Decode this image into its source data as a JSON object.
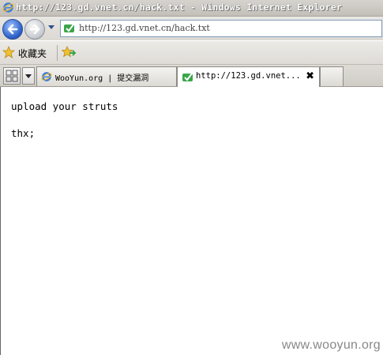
{
  "window": {
    "title": "http://123.gd.vnet.cn/hack.txt - Windows Internet Explorer"
  },
  "navigation": {
    "back_icon": "back-arrow-icon",
    "forward_icon": "forward-arrow-icon",
    "address_url": "http://123.gd.vnet.cn/hack.txt"
  },
  "favorites_bar": {
    "favorites_label": "收藏夹"
  },
  "tabs": [
    {
      "label": "WooYun.org | 提交漏洞",
      "active": false
    },
    {
      "label": "http://123.gd.vnet...",
      "active": true,
      "close": "✖"
    }
  ],
  "content": {
    "lines": [
      "upload your struts",
      "thx;"
    ]
  },
  "watermark": "www.wooyun.org",
  "colors": {
    "accent_blue": "#2d62c9",
    "page_icon_green": "#3aa64a"
  }
}
